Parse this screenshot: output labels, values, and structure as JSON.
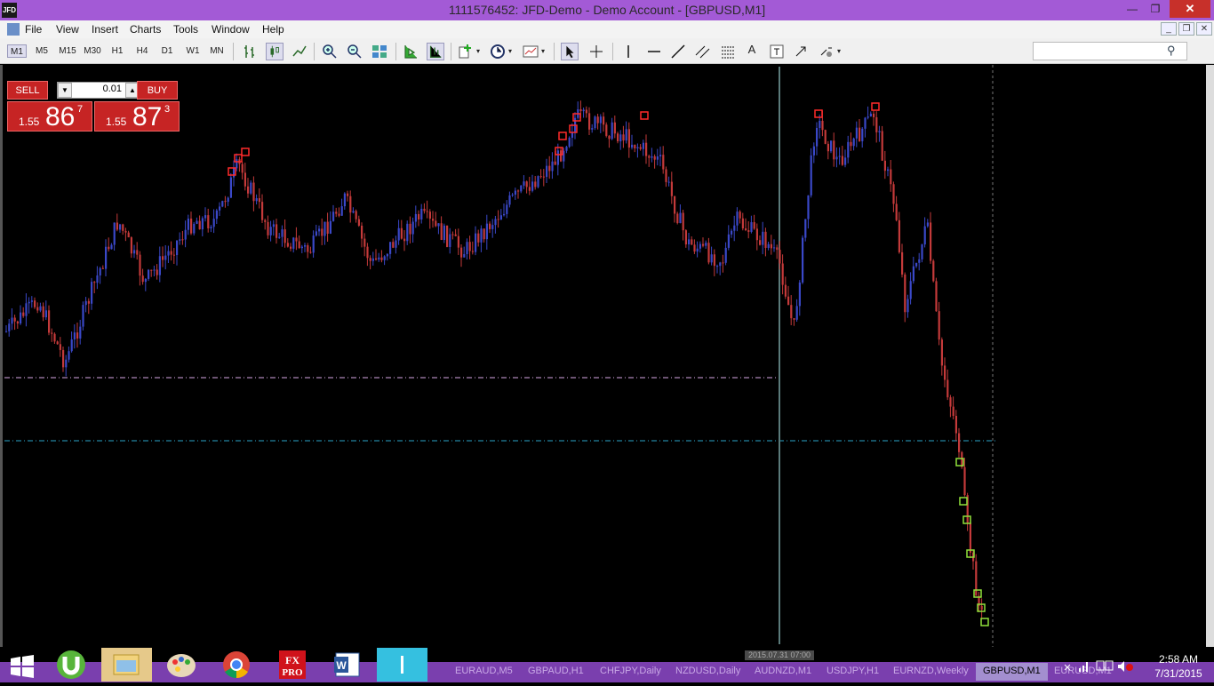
{
  "window": {
    "title": "1111576452: JFD-Demo - Demo Account - [GBPUSD,M1]",
    "logo_text": "JFD"
  },
  "menu": [
    "File",
    "View",
    "Insert",
    "Charts",
    "Tools",
    "Window",
    "Help"
  ],
  "timeframes": [
    "M1",
    "M5",
    "M15",
    "M30",
    "H1",
    "H4",
    "D1",
    "W1",
    "MN"
  ],
  "active_timeframe": "M1",
  "trade_panel": {
    "sell_label": "SELL",
    "buy_label": "BUY",
    "lot_value": "0.01",
    "sell_prefix": "1.55",
    "sell_big": "86",
    "sell_sup": "7",
    "buy_prefix": "1.55",
    "buy_big": "87",
    "buy_sup": "3"
  },
  "chart": {
    "symbol": "GBPUSD",
    "timeframe": "M1",
    "bull_color": "#3a48c8",
    "bear_color": "#c43a3a",
    "high_marker_color": "#ff2a2a",
    "low_marker_color": "#8fe03a",
    "cursor_time_label": "2015.07.31 07:00"
  },
  "chart_tabs": [
    "EURAUD,M5",
    "GBPAUD,H1",
    "CHFJPY,Daily",
    "NZDUSD,Daily",
    "AUDNZD,M1",
    "USDJPY,H1",
    "EURNZD,Weekly",
    "GBPUSD,M1",
    "EURUSD,M1"
  ],
  "active_chart_tab": "GBPUSD,M1",
  "taskbar": {
    "apps": [
      "start-button",
      "utorrent",
      "file-explorer",
      "paint",
      "chrome",
      "fxpro",
      "word",
      "metatrader"
    ],
    "time": "2:58 AM",
    "date": "7/31/2015"
  }
}
